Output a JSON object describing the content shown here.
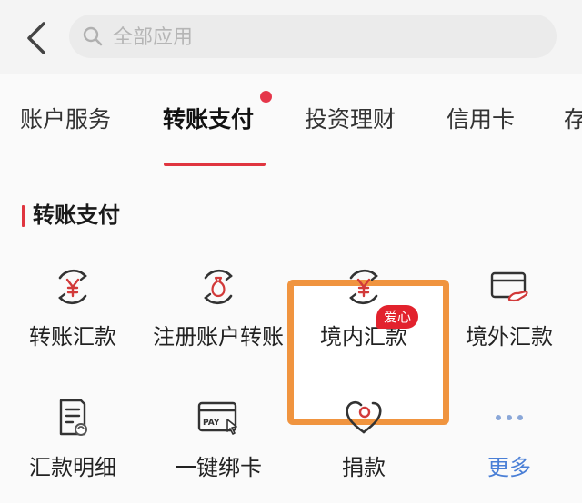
{
  "search": {
    "placeholder": "全部应用"
  },
  "tabs": [
    {
      "label": "账户服务"
    },
    {
      "label": "转账支付",
      "active": true
    },
    {
      "label": "投资理财"
    },
    {
      "label": "信用卡"
    },
    {
      "label": "存"
    }
  ],
  "section": {
    "title": "转账支付"
  },
  "items": [
    {
      "label": "转账汇款",
      "icon": "transfer-yuan-icon"
    },
    {
      "label": "注册账户转账",
      "icon": "account-transfer-icon"
    },
    {
      "label": "境内汇款",
      "icon": "domestic-remit-icon"
    },
    {
      "label": "境外汇款",
      "icon": "overseas-remit-icon"
    },
    {
      "label": "汇款明细",
      "icon": "remit-detail-icon"
    },
    {
      "label": "一键绑卡",
      "icon": "bind-card-icon",
      "icon_text": "PAY"
    },
    {
      "label": "捐款",
      "icon": "donation-heart-icon",
      "badge": "爱心"
    },
    {
      "label": "更多",
      "icon": "more-dots-icon"
    }
  ],
  "colors": {
    "accent": "#e0353f",
    "highlight": "#f0943f",
    "more": "#4a7fd6",
    "badge": "#e2222d"
  }
}
